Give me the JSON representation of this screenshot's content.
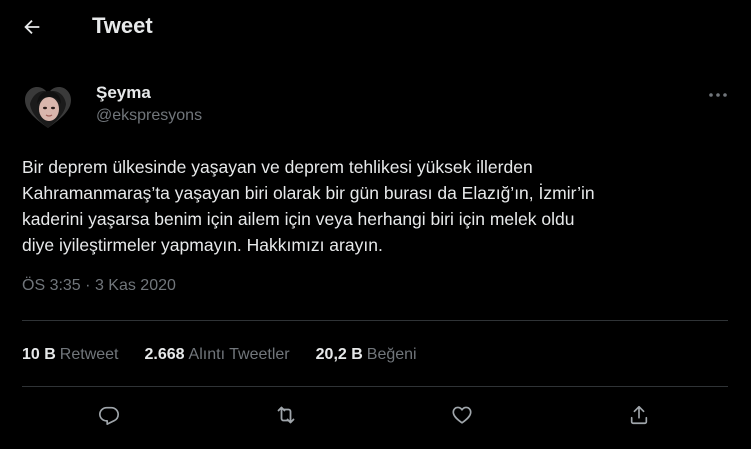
{
  "header": {
    "title": "Tweet",
    "back_icon": "arrow-left-icon"
  },
  "author": {
    "name": "Şeyma",
    "handle": "@ekspresyons",
    "avatar_icon": "heart-shaped-profile-photo"
  },
  "tweet": {
    "text": "Bir deprem ülkesinde yaşayan ve deprem tehlikesi yüksek illerden\nKahramanmaraş’ta yaşayan biri olarak bir gün burası da Elazığ’ın, İzmir’in\nkaderini yaşarsa benim için ailem için veya herhangi biri için melek oldu\ndiye iyileştirmeler yapmayın. Hakkımızı arayın.",
    "time": "ÖS 3:35",
    "separator": "·",
    "date": "3 Kas 2020"
  },
  "stats": {
    "retweets_count": "10 B",
    "retweets_label": "Retweet",
    "quotes_count": "2.668",
    "quotes_label": "Alıntı Tweetler",
    "likes_count": "20,2 B",
    "likes_label": "Beğeni"
  },
  "actions": [
    "reply-icon",
    "retweet-icon",
    "like-icon",
    "share-icon"
  ],
  "colors": {
    "background": "#000000",
    "text_primary": "#e7e9ea",
    "text_secondary": "#71767b",
    "divider": "#2f3336"
  }
}
